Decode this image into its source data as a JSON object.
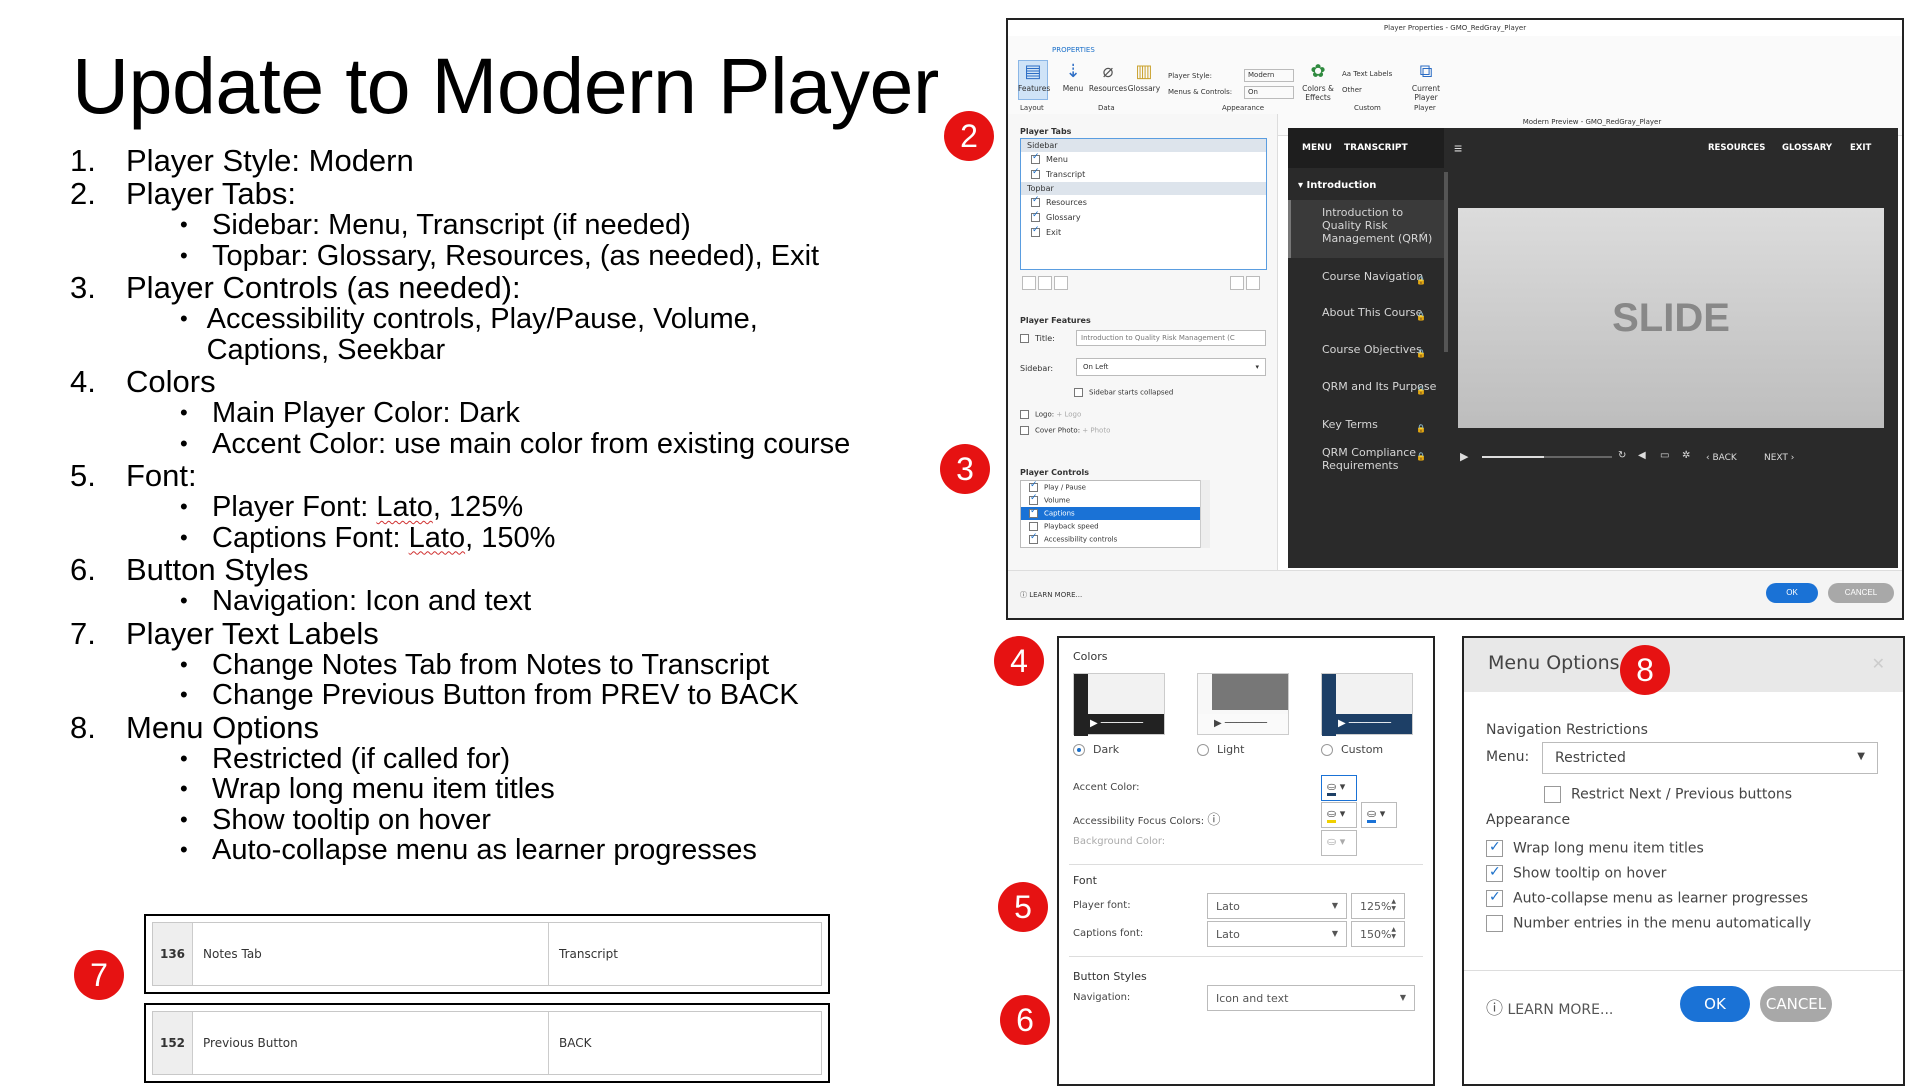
{
  "title": "Update to Modern Player",
  "outline": [
    {
      "n": "1.",
      "text": "Player Style: Modern",
      "subs": []
    },
    {
      "n": "2.",
      "text": "Player Tabs:",
      "subs": [
        "Sidebar: Menu, Transcript (if needed)",
        "Topbar: Glossary, Resources, (as needed), Exit"
      ]
    },
    {
      "n": "3.",
      "text": "Player Controls (as needed):",
      "subs": [
        "Accessibility controls, Play/Pause, Volume, Captions, Seekbar"
      ]
    },
    {
      "n": "4.",
      "text": "Colors",
      "subs": [
        "Main Player Color: Dark",
        "Accent Color: use main color from existing course"
      ]
    },
    {
      "n": "5.",
      "text": "Font:",
      "subs": [
        "Player Font: Lato, 125%",
        "Captions Font: Lato, 150%"
      ]
    },
    {
      "n": "6.",
      "text": "Button Styles",
      "subs": [
        "Navigation: Icon and text"
      ]
    },
    {
      "n": "7.",
      "text": "Player Text Labels",
      "subs": [
        "Change Notes Tab from Notes to Transcript",
        "Change Previous Button from PREV to BACK"
      ]
    },
    {
      "n": "8.",
      "text": "Menu Options",
      "subs": [
        "Restricted (if called for)",
        "Wrap long menu item titles",
        "Show tooltip on hover",
        "Auto-collapse menu as learner progresses"
      ]
    }
  ],
  "badges": {
    "b2": "2",
    "b3": "3",
    "b4": "4",
    "b5": "5",
    "b6": "6",
    "b7": "7",
    "b8": "8"
  },
  "labels": [
    {
      "id": "136",
      "name": "Notes Tab",
      "value": "Transcript"
    },
    {
      "id": "152",
      "name": "Previous Button",
      "value": "BACK"
    }
  ],
  "player_properties": {
    "window_title": "Player Properties - GMO_RedGray_Player",
    "ribbon_tab": "PROPERTIES",
    "ribbon_buttons": {
      "features": "Features",
      "menu": "Menu",
      "resources": "Resources",
      "glossary": "Glossary",
      "colors": "Colors & Effects",
      "text_labels": "Aa Text Labels",
      "other": "Other",
      "current_player": "Current Player"
    },
    "ribbon_groups": {
      "layout": "Layout",
      "data": "Data",
      "appearance": "Appearance",
      "custom": "Custom",
      "player": "Player"
    },
    "player_style_label": "Player Style:",
    "player_style_value": "Modern",
    "menus_controls_label": "Menus & Controls:",
    "menus_controls_value": "On",
    "player_tabs_header": "Player Tabs",
    "sidebar_group": "Sidebar",
    "topbar_group": "Topbar",
    "tab_items": {
      "menu": "Menu",
      "transcript": "Transcript",
      "resources": "Resources",
      "glossary": "Glossary",
      "exit": "Exit"
    },
    "features_header": "Player Features",
    "title_label": "Title:",
    "title_value": "Introduction to Quality Risk Management (C",
    "sidebar_label": "Sidebar:",
    "sidebar_value": "On Left",
    "sidebar_collapsed": "Sidebar starts collapsed",
    "logo_label": "Logo:",
    "logo_add": "+ Logo",
    "cover_label": "Cover Photo:",
    "cover_add": "+ Photo",
    "controls_header": "Player Controls",
    "controls": {
      "play": "Play / Pause",
      "volume": "Volume",
      "captions": "Captions",
      "speed": "Playback speed",
      "access": "Accessibility controls"
    },
    "learn_more": "LEARN MORE...",
    "ok": "OK",
    "cancel": "CANCEL",
    "preview_title": "Modern Preview - GMO_RedGray_Player",
    "preview": {
      "tab_menu": "MENU",
      "tab_transcript": "TRANSCRIPT",
      "top_resources": "RESOURCES",
      "top_glossary": "GLOSSARY",
      "top_exit": "EXIT",
      "section": "Introduction",
      "items": [
        "Introduction to Quality Risk Management (QRM)",
        "Course Navigation",
        "About This Course",
        "Course Objectives",
        "QRM and Its Purpose",
        "Key Terms",
        "QRM Compliance Requirements"
      ],
      "slide": "SLIDE",
      "back": "BACK",
      "next": "NEXT"
    }
  },
  "colors_panel": {
    "header": "Colors",
    "dark": "Dark",
    "light": "Light",
    "custom": "Custom",
    "accent_label": "Accent Color:",
    "focus_label": "Accessibility Focus Colors:",
    "bg_label": "Background Color:",
    "font_header": "Font",
    "player_font_label": "Player font:",
    "player_font": "Lato",
    "player_font_size": "125%",
    "captions_font_label": "Captions font:",
    "captions_font": "Lato",
    "captions_font_size": "150%",
    "buttons_header": "Button Styles",
    "nav_label": "Navigation:",
    "nav_value": "Icon and text"
  },
  "menu_options": {
    "title": "Menu Options",
    "nav_header": "Navigation Restrictions",
    "menu_label": "Menu:",
    "menu_value": "Restricted",
    "restrict_next": "Restrict Next / Previous buttons",
    "appearance_header": "Appearance",
    "wrap": "Wrap long menu item titles",
    "tooltip": "Show tooltip on hover",
    "autocollapse": "Auto-collapse menu as learner progresses",
    "number": "Number entries in the menu automatically",
    "learn_more": "LEARN MORE...",
    "ok": "OK",
    "cancel": "CANCEL"
  },
  "colors": {
    "badge": "#e61212",
    "blue": "#1a72d6",
    "dark_player": "#2a2a2a",
    "accent_blue": "#1d3f66"
  }
}
